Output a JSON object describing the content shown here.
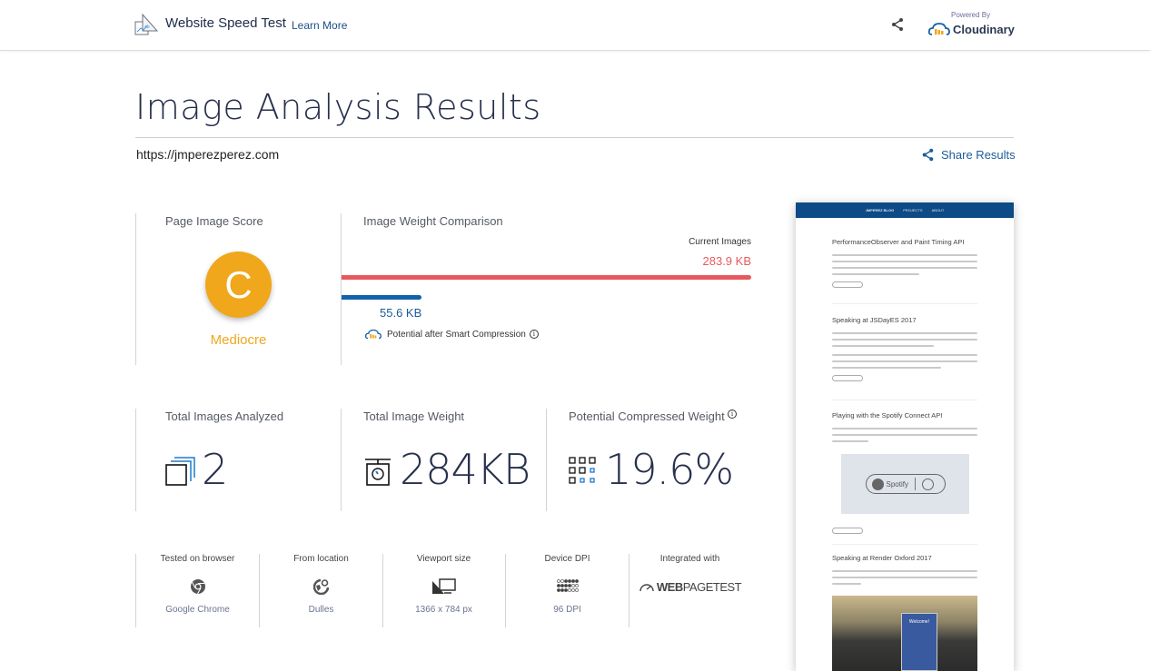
{
  "header": {
    "app_title": "Website Speed Test",
    "learn_more": "Learn More",
    "powered_by": "Powered By",
    "brand": "Cloudinary",
    "icons": {
      "logo": "speed-test-logo-icon",
      "share": "share-icon",
      "brand": "cloudinary-cloud-icon"
    }
  },
  "page": {
    "title": "Image Analysis Results",
    "url": "https://jmperezperez.com",
    "share_results": "Share Results"
  },
  "score": {
    "label": "Page Image Score",
    "grade": "C",
    "grade_text": "Mediocre",
    "grade_color": "#f0a71c"
  },
  "weight_comparison": {
    "label": "Image Weight Comparison",
    "current_label": "Current Images",
    "current_value": "283.9 KB",
    "current_kb": 283.9,
    "compressed_value": "55.6 KB",
    "compressed_kb": 55.6,
    "compressed_caption": "Potential after Smart Compression",
    "current_color": "#e8575d",
    "compressed_color": "#1262a8"
  },
  "stats": [
    {
      "label": "Total Images Analyzed",
      "value": "2",
      "icon": "stacked-images-icon"
    },
    {
      "label": "Total Image Weight",
      "value": "284KB",
      "icon": "scale-icon"
    },
    {
      "label": "Potential Compressed Weight",
      "value": "19.6%",
      "icon": "grid-compress-icon"
    }
  ],
  "meta": [
    {
      "title": "Tested on browser",
      "value": "Google Chrome",
      "icon": "chrome-icon"
    },
    {
      "title": "From location",
      "value": "Dulles",
      "icon": "globe-pin-icon"
    },
    {
      "title": "Viewport size",
      "value": "1366 x 784 px",
      "icon": "viewport-icon"
    },
    {
      "title": "Device DPI",
      "value": "96 DPI",
      "icon": "dpi-dots-icon"
    },
    {
      "title": "Integrated with",
      "value": "",
      "logo_text_bold": "WEB",
      "logo_text": "PAGETEST",
      "icon": "webpagetest-gauge-icon"
    }
  ],
  "preview": {
    "nav": [
      "JMPEREZ BLOG",
      "PROJECTS",
      "ABOUT"
    ],
    "posts": [
      "PerformanceObserver and Paint Timing API",
      "Speaking at JSDayES 2017",
      "Playing with the Spotify Connect API",
      "Speaking at Render Oxford 2017"
    ],
    "spotify_label": "Spotify",
    "photo_sign": "Welcome!"
  }
}
